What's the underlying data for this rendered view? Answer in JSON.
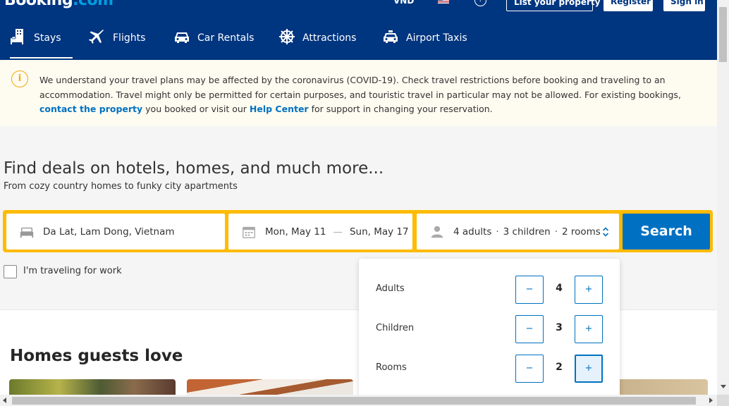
{
  "header": {
    "logo_main": "Booking",
    "logo_suffix": ".com",
    "currency": "VND",
    "help_icon": "question-circle-icon",
    "list_property": "List your property",
    "register": "Register",
    "sign_in": "Sign in",
    "brand_color": "#003580"
  },
  "nav": {
    "items": [
      {
        "label": "Stays",
        "icon": "bed-building-icon",
        "active": true
      },
      {
        "label": "Flights",
        "icon": "plane-icon"
      },
      {
        "label": "Car Rentals",
        "icon": "car-icon"
      },
      {
        "label": "Attractions",
        "icon": "attractions-icon"
      },
      {
        "label": "Airport Taxis",
        "icon": "taxi-icon"
      }
    ]
  },
  "notice": {
    "icon": "info-circle-icon",
    "text_1": "We understand your travel plans may be affected by the coronavirus (COVID-19). Check travel restrictions before booking and traveling to an accommodation. Travel might only be permitted for certain purposes, and touristic travel in particular may not be allowed. For existing bookings, ",
    "link_1": "contact the property",
    "text_2": " you booked or visit our ",
    "link_2": "Help Center",
    "text_3": " for support in changing your reservation."
  },
  "hero": {
    "title": "Find deals on hotels, homes, and much more...",
    "subtitle": "From cozy country homes to funky city apartments"
  },
  "search": {
    "destination": "Da Lat, Lam Dong, Vietnam",
    "check_in": "Mon, May 11",
    "date_separator": "—",
    "check_out": "Sun, May 17",
    "adults_summary": "4 adults",
    "children_summary": "3 children",
    "rooms_summary": "2 rooms",
    "dot": "·",
    "button": "Search",
    "accent_color": "#febb02",
    "button_color": "#0071c2"
  },
  "work_travel": {
    "label": "I'm traveling for work",
    "checked": false
  },
  "guests": {
    "rows": [
      {
        "label": "Adults",
        "value": "4"
      },
      {
        "label": "Children",
        "value": "3"
      },
      {
        "label": "Rooms",
        "value": "2"
      }
    ],
    "minus": "−",
    "plus": "+"
  },
  "section": {
    "title": "Homes guests love"
  }
}
